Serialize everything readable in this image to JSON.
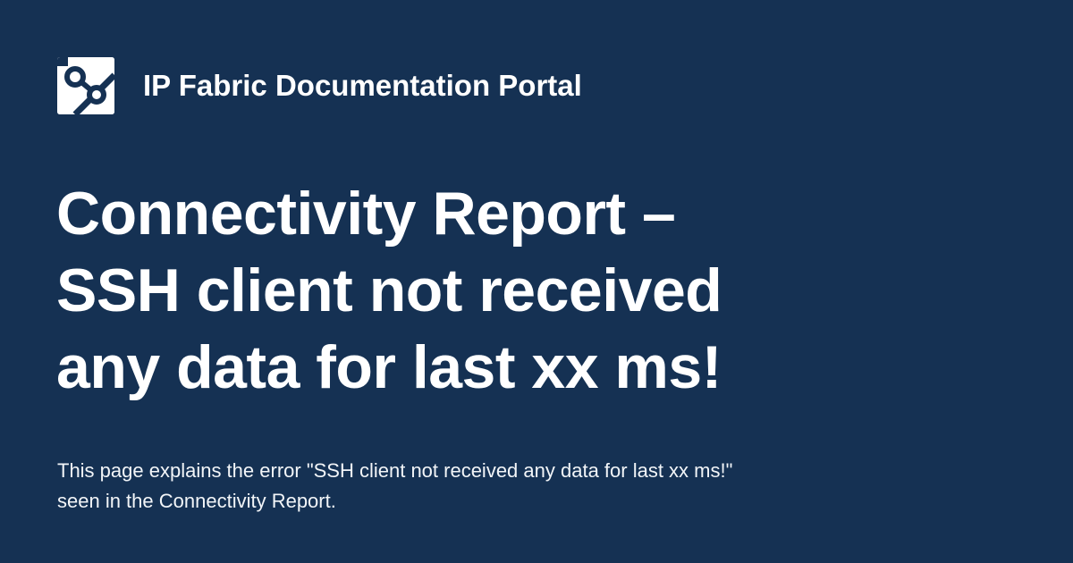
{
  "header": {
    "logo_icon": "ip-fabric-logo-icon",
    "site_name": "IP Fabric Documentation Portal"
  },
  "main": {
    "title": "Connectivity Report – SSH client not received any data for last xx ms!",
    "description": "This page explains the error \"SSH client not received any data for last xx ms!\" seen in the Connectivity Report."
  },
  "colors": {
    "background": "#153153",
    "text": "#ffffff",
    "logo_tile": "#ffffff"
  }
}
